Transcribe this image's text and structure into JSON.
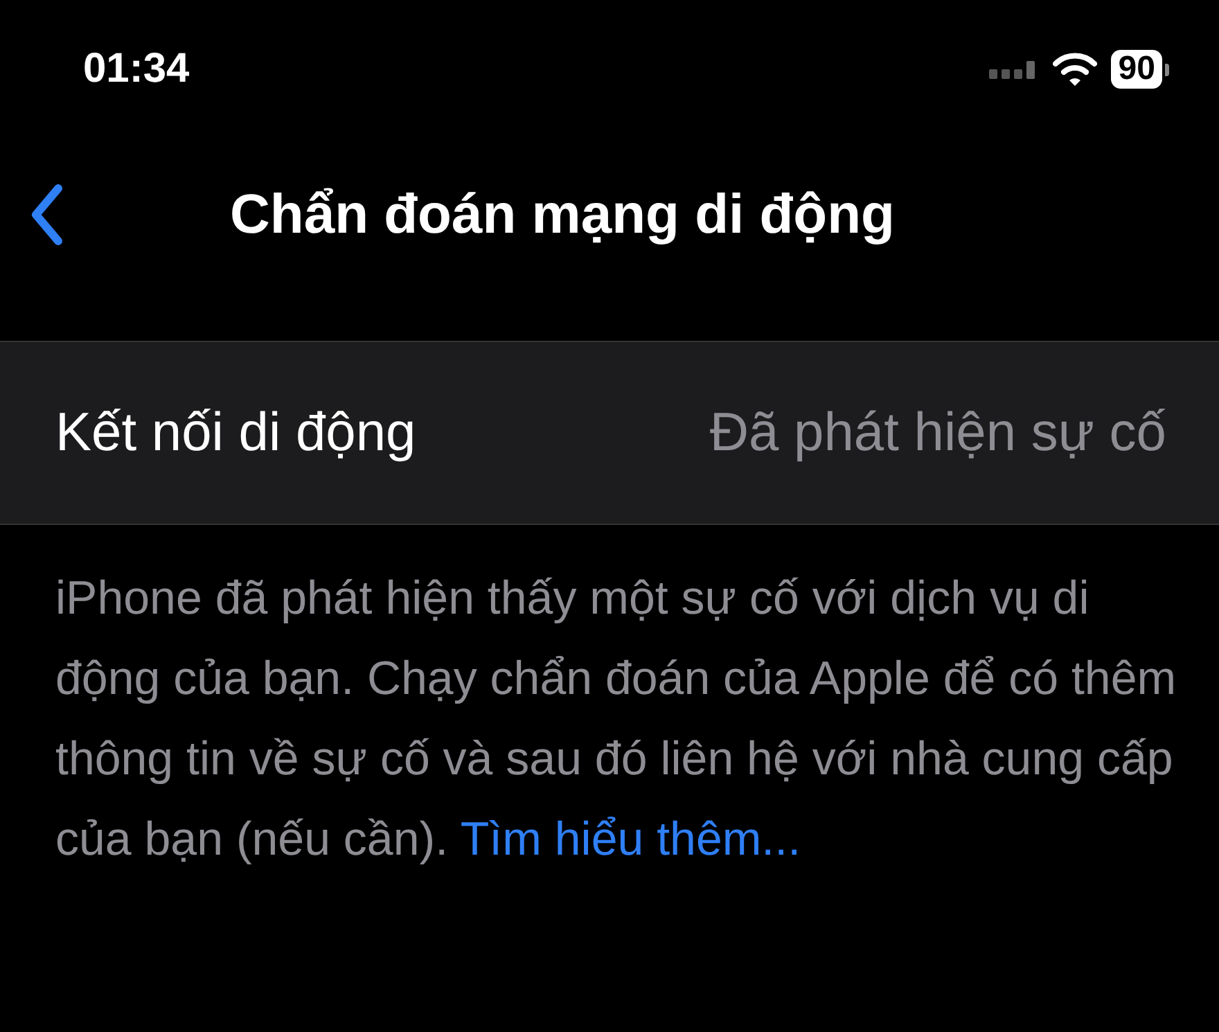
{
  "status_bar": {
    "time": "01:34",
    "battery": "90"
  },
  "nav": {
    "title": "Chẩn đoán mạng di động"
  },
  "cell": {
    "label": "Kết nối di động",
    "value": "Đã phát hiện sự cố"
  },
  "footer": {
    "text": "iPhone đã phát hiện thấy một sự cố với dịch vụ di động của bạn. Chạy chẩn đoán của Apple để có thêm thông tin về sự cố và sau đó liên hệ với nhà cung cấp của bạn (nếu cần).",
    "link": "Tìm hiểu thêm..."
  }
}
